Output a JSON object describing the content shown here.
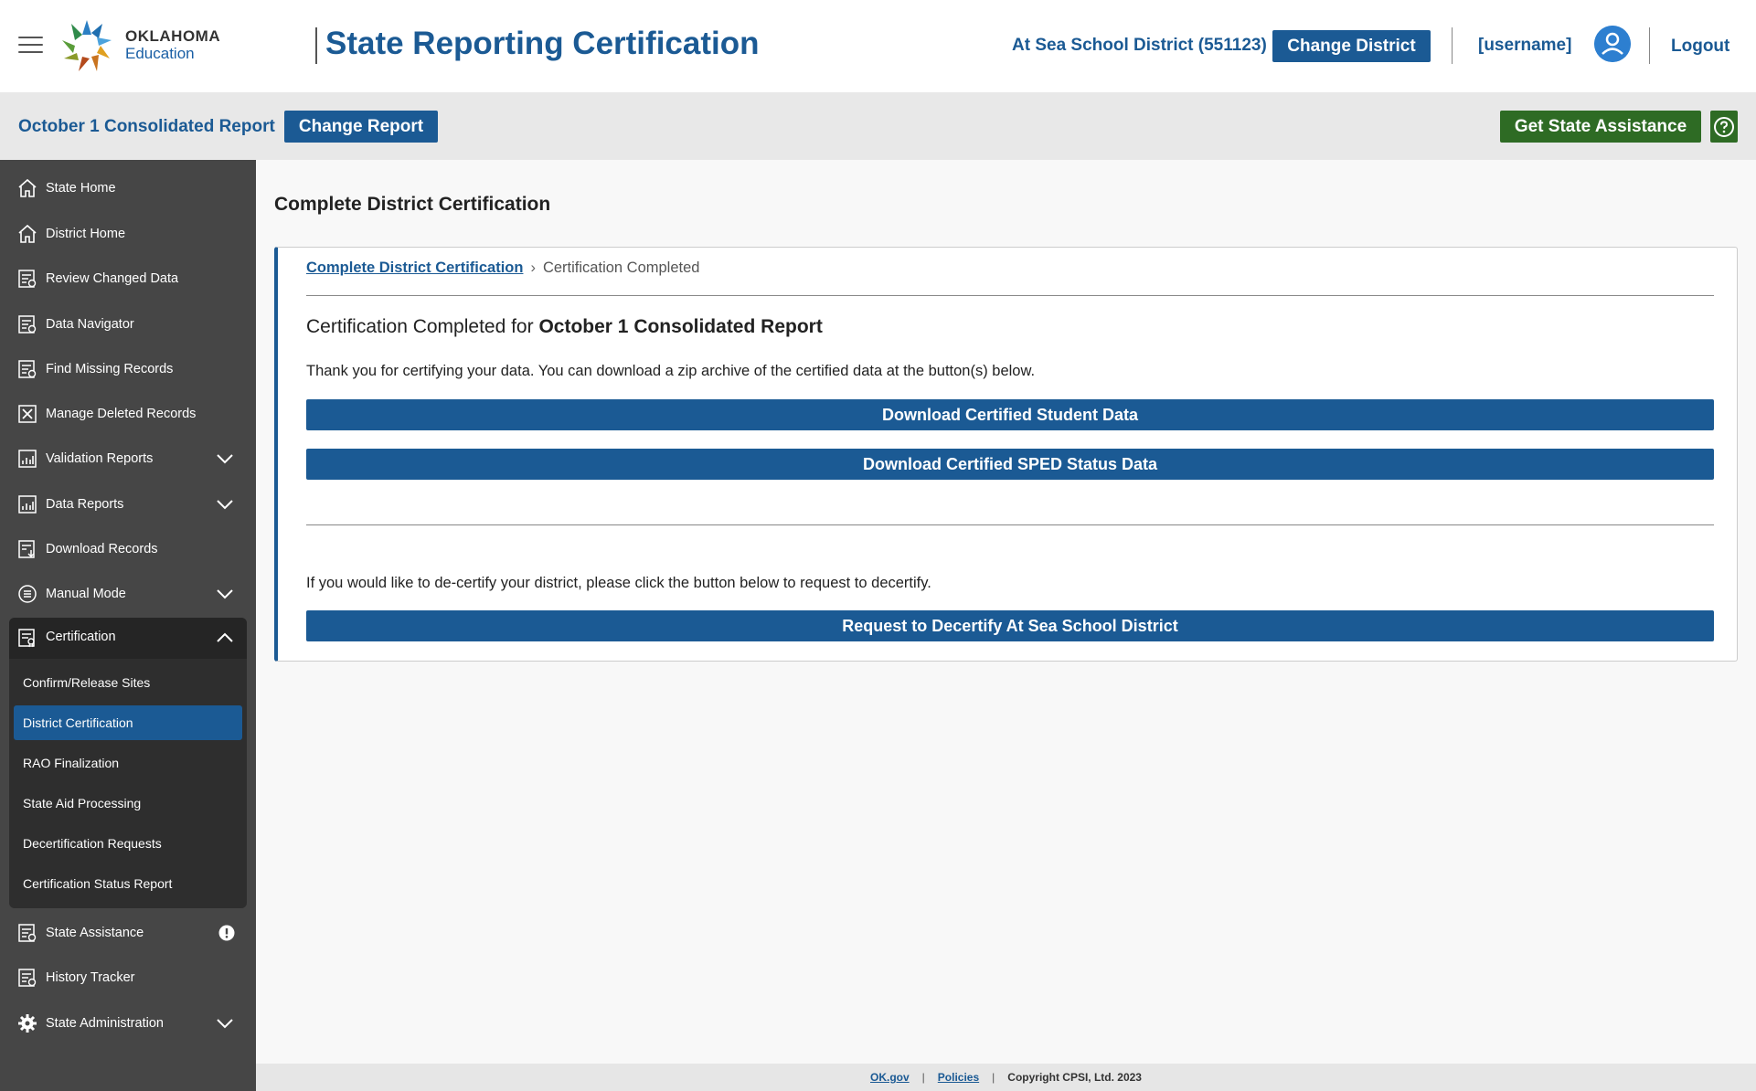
{
  "header": {
    "logo_line1": "OKLAHOMA",
    "logo_line2": "Education",
    "app_title": "State Reporting Certification",
    "district": "At Sea School District (551123)",
    "change_district_label": "Change District",
    "username": "[username]",
    "logout_label": "Logout"
  },
  "report_bar": {
    "report_name": "October 1 Consolidated Report",
    "change_report_label": "Change Report",
    "state_assistance_label": "Get State Assistance"
  },
  "sidebar": {
    "items": [
      {
        "label": "State Home",
        "icon": "home-icon"
      },
      {
        "label": "District Home",
        "icon": "home-icon"
      },
      {
        "label": "Review Changed Data",
        "icon": "report-icon"
      },
      {
        "label": "Data Navigator",
        "icon": "report-icon"
      },
      {
        "label": "Find Missing Records",
        "icon": "report-icon"
      },
      {
        "label": "Manage Deleted Records",
        "icon": "delete-icon"
      },
      {
        "label": "Validation Reports",
        "icon": "chart-icon"
      },
      {
        "label": "Data Reports",
        "icon": "chart-icon"
      },
      {
        "label": "Download Records",
        "icon": "download-icon"
      },
      {
        "label": "Manual Mode",
        "icon": "list-icon"
      },
      {
        "label": "Certification",
        "icon": "certificate-icon"
      },
      {
        "label": "State Assistance",
        "icon": "report-icon"
      },
      {
        "label": "History Tracker",
        "icon": "report-icon"
      },
      {
        "label": "State Administration",
        "icon": "gear-icon"
      }
    ],
    "certification_sub": [
      "Confirm/Release Sites",
      "District Certification",
      "RAO Finalization",
      "State Aid Processing",
      "Decertification Requests",
      "Certification Status Report"
    ],
    "active_sub": "District Certification"
  },
  "main": {
    "page_title": "Complete District Certification",
    "breadcrumb_link": "Complete District Certification",
    "breadcrumb_current": "Certification Completed",
    "cert_heading_prefix": "Certification Completed for",
    "cert_heading_report": "October 1 Consolidated Report",
    "thank_text": "Thank you for certifying your data. You can download a zip archive of the certified data at the button(s) below.",
    "download_student_label": "Download Certified Student Data",
    "download_sped_label": "Download Certified SPED Status Data",
    "decertify_text": "If you would like to de-certify your district, please click the button below to request to decertify.",
    "decertify_button_label": "Request to Decertify At Sea School District"
  },
  "footer": {
    "link1": "OK.gov",
    "link2": "Policies",
    "copyright": "Copyright CPSI, Ltd. 2023"
  },
  "colors": {
    "brand_blue": "#1b5a94",
    "assist_green": "#2e6b24",
    "sidebar_bg": "#464646",
    "active_sub_bg": "#1b5a94"
  }
}
